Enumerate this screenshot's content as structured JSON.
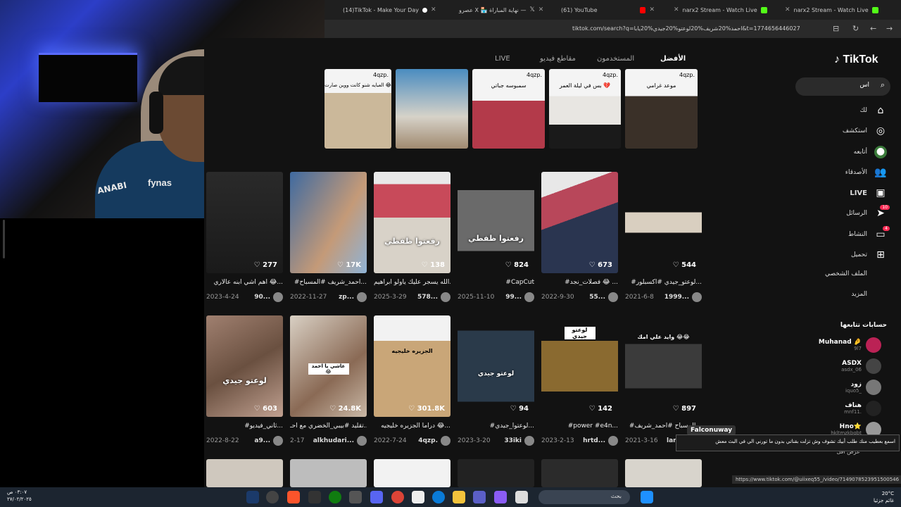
{
  "browser": {
    "tabs": [
      {
        "label": "(14)TikTok - Make Your Day",
        "icon": "tiktok-icon"
      },
      {
        "label": "عصرو X 🏪 نهاية المباراة —",
        "icon": "x-icon"
      },
      {
        "label": "(61) YouTube",
        "icon": "youtube-icon"
      },
      {
        "label": "narx2 Stream - Watch Live",
        "icon": "kick-icon"
      },
      {
        "label": "narx2 Stream - Watch Live",
        "icon": "kick-icon"
      }
    ],
    "url": "tiktok.com/search?q=احمد%20شريف%20لوعتو%20جيدي%20يابا&t=1774656446027"
  },
  "tiktok": {
    "logo": "TikTok",
    "search_value": "اس",
    "tabs": [
      "الأفضل",
      "المستخدمون",
      "مقاطع فيديو",
      "LIVE"
    ],
    "nav": [
      {
        "label": "لك",
        "icon": "home-icon"
      },
      {
        "label": "استكشف",
        "icon": "compass-icon"
      },
      {
        "label": "أتابعه",
        "icon": "following-avatar-icon"
      },
      {
        "label": "الأصدقاء",
        "icon": "friends-icon"
      },
      {
        "label": "LIVE",
        "icon": "live-icon"
      },
      {
        "label": "الرسائل",
        "icon": "messages-icon",
        "badge": "10"
      },
      {
        "label": "النشاط",
        "icon": "activity-icon",
        "badge": "4"
      },
      {
        "label": "تحميل",
        "icon": "upload-icon"
      },
      {
        "label": "الملف الشخصي",
        "icon": "profile-icon"
      },
      {
        "label": "المزيد",
        "icon": "more-icon"
      }
    ],
    "following_title": "حسابات تتابعها",
    "following": [
      {
        "name": "Muhanad 🤌",
        "handle": "9l7"
      },
      {
        "name": "ASDX",
        "handle": "asdx_06"
      },
      {
        "name": "زود",
        "handle": "iquo5_"
      },
      {
        "name": "هناف",
        "handle": "mnf11."
      },
      {
        "name": "Hno⭐",
        "handle": "hkltmzkbqbt"
      }
    ],
    "show_more": "عرض أقل",
    "top_row_captions": [
      "4qzp.",
      "4qzp.",
      "4qzp.",
      "",
      "4qzp."
    ],
    "top_row_texts": [
      "موعد غرامي",
      "بس في ليلة العمر 💔",
      "سمبوسه جباتي",
      "",
      "العبايه شنو كانت ووين صارت 😂"
    ],
    "videos_row1": [
      {
        "count": "544",
        "caption": "#لوعتو_جيدي #اكسبلور...",
        "user": "1999...",
        "date": "2021-6-8",
        "overlay": ""
      },
      {
        "count": "673",
        "caption": "#فصلات_نجد 😂 ...",
        "user": "55...",
        "date": "2022-9-30",
        "overlay": ""
      },
      {
        "count": "824",
        "caption": "#CapCut",
        "user": "99...",
        "date": "2025-11-10",
        "overlay": "رفعتوا ظفطي"
      },
      {
        "count": "138",
        "caption": "الله يسجر عليك ياولو ابراهيم...",
        "user": "578...",
        "date": "2025-3-29",
        "overlay": "رفعتوا ظفطي"
      },
      {
        "count": "17K",
        "caption": "#احمد_شريف #المسباح...",
        "user": "zp...",
        "date": "2022-11-27",
        "overlay": ""
      },
      {
        "count": "277",
        "caption": "اهم اشي ابنه عالاري 😂...",
        "user": "90...",
        "date": "2023-4-24",
        "overlay": ""
      }
    ],
    "videos_row2": [
      {
        "count": "897",
        "caption": "#المسباح #احمد_شريف...",
        "user": "lano...",
        "date": "2021-3-16",
        "overlay": "وايد علي امك 😂😂"
      },
      {
        "count": "142",
        "caption": "#power #e4n...",
        "user": "hrtd...",
        "date": "2023-2-13",
        "overlay": "لوعتو جيدي"
      },
      {
        "count": "94",
        "caption": "#لوعتوا_جيدي...",
        "user": "33iki",
        "date": "2023-3-20",
        "overlay": "لوعتو جيدي"
      },
      {
        "count": "301.8K",
        "caption": "دراما الجزيره خليجيه 😂...",
        "user": "4qzp.",
        "date": "2022-7-24",
        "overlay": "الجزيره خليجيه"
      },
      {
        "count": "24.8K",
        "caption": "تقليد #بيبي_الخضري مع أحـ...",
        "user": "alkhudari...",
        "date": "2-17",
        "overlay": "عاشي يا احمد 😂"
      },
      {
        "count": "603",
        "caption": "#ثاني_فيديو...",
        "user": "a9...",
        "date": "2022-8-22",
        "overlay": "لوعتو جيدي"
      }
    ],
    "tooltip": "Falconuway",
    "comment": "اسمع بعطيب منك طلب أبيك تشوف وش تزلت بقناتي بدون ما تورني الي في البث معش",
    "status_url": "https://www.tiktok.com/@uiixeq55_/video/7149078523951500546"
  },
  "taskbar": {
    "time": "٠٣:٠٧ ص",
    "date": "٢٧/٠٢/٢٠٢٥",
    "search_placeholder": "بحث",
    "weather_temp": "20°C",
    "weather_desc": "غائم جزئيا"
  },
  "webcam": {
    "shirt_brand": "fynas",
    "shirt_text": "ANABI"
  }
}
